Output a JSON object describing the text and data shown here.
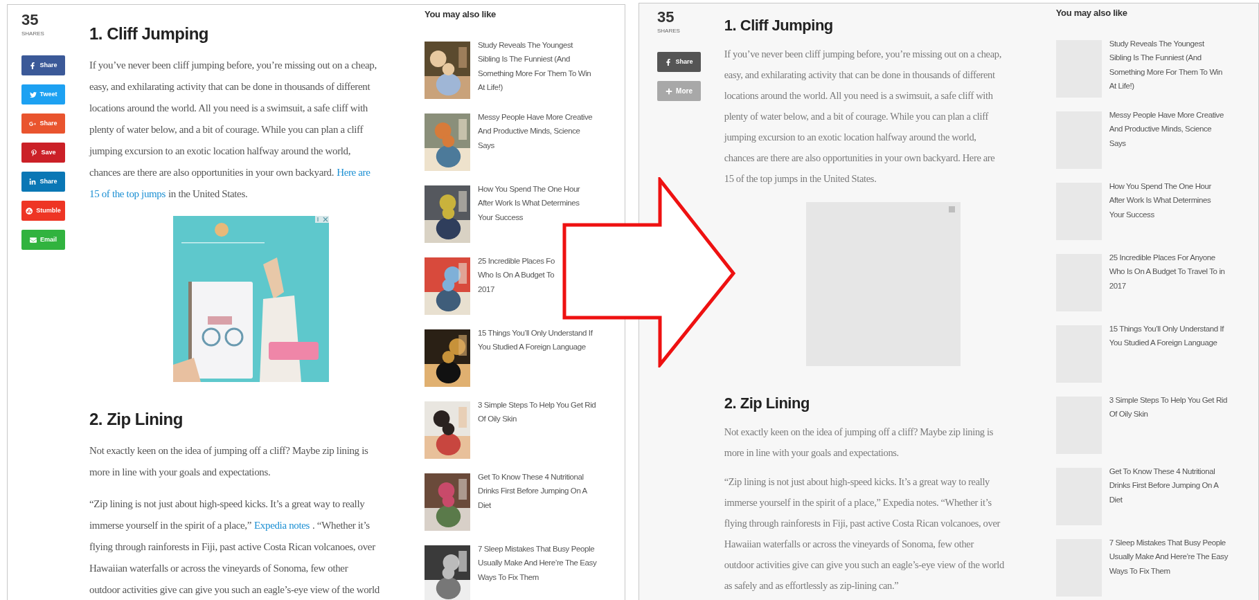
{
  "panels": [
    {
      "images_loaded": true,
      "share_count": "35",
      "share_label": "SHARES",
      "share_buttons": [
        {
          "kind": "facebook",
          "label": "Share",
          "color": "#3b5998"
        },
        {
          "kind": "twitter",
          "label": "Tweet",
          "color": "#1da1f2"
        },
        {
          "kind": "googleplus",
          "label": "Share",
          "color": "#e9542e"
        },
        {
          "kind": "pinterest",
          "label": "Save",
          "color": "#cb2027"
        },
        {
          "kind": "linkedin",
          "label": "Share",
          "color": "#0a77b5"
        },
        {
          "kind": "stumbleupon",
          "label": "Stumble",
          "color": "#ee3524"
        },
        {
          "kind": "email",
          "label": "Email",
          "color": "#31b33f"
        }
      ],
      "sections": [
        {
          "heading": "1. Cliff Jumping",
          "ad": true,
          "paragraphs": [
            [
              [
                {
                  "text": "If you’ve never been cliff jumping before, you’re missing out on a cheap,",
                  "link": false
                }
              ],
              [
                {
                  "text": "easy, and exhilarating activity that can be done in thousands of different",
                  "link": false
                }
              ],
              [
                {
                  "text": "locations around the world. All you need is a swimsuit, a safe cliff with",
                  "link": false
                }
              ],
              [
                {
                  "text": "plenty of water below, and a bit of courage. While you can plan a cliff",
                  "link": false
                }
              ],
              [
                {
                  "text": "jumping excursion to an exotic location halfway around the world,",
                  "link": false
                }
              ],
              [
                {
                  "text": "chances are there are also opportunities in your own backyard.",
                  "link": false
                },
                {
                  "text": "Here are",
                  "link": true
                }
              ],
              [
                {
                  "text": "15 of the top jumps",
                  "link": true
                },
                {
                  "text": "in the United States.",
                  "link": false
                }
              ]
            ]
          ]
        },
        {
          "heading": "2. Zip Lining",
          "ad": false,
          "paragraphs": [
            [
              [
                {
                  "text": "Not exactly keen on the idea of jumping off a cliff? Maybe zip lining is",
                  "link": false
                }
              ],
              [
                {
                  "text": "more in line with your goals and expectations.",
                  "link": false
                }
              ]
            ],
            [
              [
                {
                  "text": "“Zip lining is not just about high-speed kicks. It’s a great way to really",
                  "link": false
                }
              ],
              [
                {
                  "text": "immerse yourself in the spirit of a place,”",
                  "link": false
                },
                {
                  "text": "Expedia notes",
                  "link": true
                },
                {
                  "text": ". “Whether it’s",
                  "link": false
                }
              ],
              [
                {
                  "text": "flying through rainforests in Fiji, past active Costa Rican volcanoes, over",
                  "link": false
                }
              ],
              [
                {
                  "text": "Hawaiian waterfalls or across the vineyards of Sonoma, few other",
                  "link": false
                }
              ],
              [
                {
                  "text": "outdoor activities give can give you such an eagle’s-eye view of the world",
                  "link": false
                }
              ]
            ]
          ]
        }
      ],
      "sidebar": {
        "title": "You may also like",
        "items": [
          {
            "title_lines": [
              "Study Reveals The Youngest",
              "Sibling Is The Funniest (And",
              "Something More For Them To Win",
              "At Life!)"
            ]
          },
          {
            "title_lines": [
              "Messy People Have More Creative",
              "And Productive Minds, Science",
              "Says"
            ]
          },
          {
            "title_lines": [
              "How You Spend The One Hour",
              "After Work Is What Determines",
              "Your Success"
            ]
          },
          {
            "title_lines": [
              "25 Incredible Places Fo",
              "Who Is On A Budget To",
              "2017"
            ]
          },
          {
            "title_lines": [
              "15 Things You’ll Only Understand If",
              "You Studied A Foreign Language"
            ]
          },
          {
            "title_lines": [
              "3 Simple Steps To Help You Get Rid",
              "Of Oily Skin"
            ]
          },
          {
            "title_lines": [
              "Get To Know These 4 Nutritional",
              "Drinks First Before Jumping On A",
              "Diet"
            ]
          },
          {
            "title_lines": [
              "7 Sleep Mistakes That Busy People",
              "Usually Make And Here’re The Easy",
              "Ways To Fix Them"
            ]
          }
        ]
      }
    },
    {
      "images_loaded": false,
      "share_count": "35",
      "share_label": "SHARES",
      "share_buttons": [
        {
          "kind": "facebook",
          "label": "Share",
          "color": "#555555"
        },
        {
          "kind": "more",
          "label": "More",
          "color": "#a8a8a8"
        }
      ],
      "sections": [
        {
          "heading": "1. Cliff Jumping",
          "ad": true,
          "paragraphs": [
            [
              [
                {
                  "text": "If you’ve never been cliff jumping before, you’re missing out on a cheap,",
                  "link": false
                }
              ],
              [
                {
                  "text": "easy, and exhilarating activity that can be done in thousands of different",
                  "link": false
                }
              ],
              [
                {
                  "text": "locations around the world. All you need is a swimsuit, a safe cliff with",
                  "link": false
                }
              ],
              [
                {
                  "text": "plenty of water below, and a bit of courage. While you can plan a cliff",
                  "link": false
                }
              ],
              [
                {
                  "text": "jumping excursion to an exotic location halfway around the world,",
                  "link": false
                }
              ],
              [
                {
                  "text": "chances are there are also opportunities in your own backyard. Here are",
                  "link": false
                }
              ],
              [
                {
                  "text": "15 of the top jumps in the United States.",
                  "link": false
                }
              ]
            ]
          ]
        },
        {
          "heading": "2. Zip Lining",
          "ad": false,
          "paragraphs": [
            [
              [
                {
                  "text": "Not exactly keen on the idea of jumping off a cliff? Maybe zip lining is",
                  "link": false
                }
              ],
              [
                {
                  "text": "more in line with your goals and expectations.",
                  "link": false
                }
              ]
            ],
            [
              [
                {
                  "text": "“Zip lining is not just about high-speed kicks. It’s a great way to really",
                  "link": false
                }
              ],
              [
                {
                  "text": "immerse yourself in the spirit of a place,” Expedia notes. “Whether it’s",
                  "link": false
                }
              ],
              [
                {
                  "text": "flying through rainforests in Fiji, past active Costa Rican volcanoes, over",
                  "link": false
                }
              ],
              [
                {
                  "text": "Hawaiian waterfalls or across the vineyards of Sonoma, few other",
                  "link": false
                }
              ],
              [
                {
                  "text": "outdoor activities give can give you such an eagle’s-eye view of the world",
                  "link": false
                }
              ],
              [
                {
                  "text": "as safely and as effortlessly as zip-lining can.”",
                  "link": false
                }
              ]
            ]
          ]
        }
      ],
      "sidebar": {
        "title": "You may also like",
        "items": [
          {
            "title_lines": [
              "Study Reveals The Youngest",
              "Sibling Is The Funniest (And",
              "Something More For Them To Win",
              "At Life!)"
            ]
          },
          {
            "title_lines": [
              "Messy People Have More Creative",
              "And Productive Minds, Science",
              "Says"
            ]
          },
          {
            "title_lines": [
              "How You Spend The One Hour",
              "After Work Is What Determines",
              "Your Success"
            ]
          },
          {
            "title_lines": [
              "25 Incredible Places For Anyone",
              "Who Is On A Budget To Travel To in",
              "2017"
            ]
          },
          {
            "title_lines": [
              "15 Things You’ll Only Understand If",
              "You Studied A Foreign Language"
            ]
          },
          {
            "title_lines": [
              "3 Simple Steps To Help You Get Rid",
              "Of Oily Skin"
            ]
          },
          {
            "title_lines": [
              "Get To Know These 4 Nutritional",
              "Drinks First Before Jumping On A",
              "Diet"
            ]
          },
          {
            "title_lines": [
              "7 Sleep Mistakes That Busy People",
              "Usually Make And Here’re The Easy",
              "Ways To Fix Them"
            ]
          }
        ]
      }
    }
  ]
}
